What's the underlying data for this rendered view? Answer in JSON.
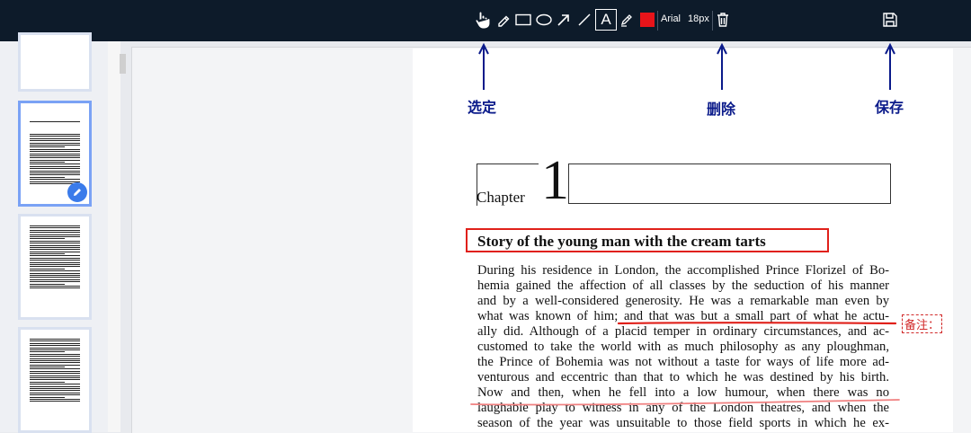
{
  "toolbar": {
    "font_name": "Arial",
    "font_size": "18px",
    "text_tool_glyph": "A",
    "color": "#e8141a",
    "icons": [
      "hand-select-icon",
      "eraser-icon",
      "rectangle-icon",
      "ellipse-icon",
      "arrow-icon",
      "line-icon",
      "text-icon",
      "highlighter-icon",
      "color-swatch",
      "trash-icon",
      "save-icon"
    ]
  },
  "annotations": {
    "select_label": "选定",
    "delete_label": "删除",
    "save_label": "保存",
    "arrow_color": "#0a1a8a"
  },
  "document": {
    "chapter_word": "Chapter",
    "chapter_number": "1",
    "title": "Story of the young man with the cream tarts",
    "lines": [
      "During his residence in London, the accomplished Prince Florizel of Bo-",
      "hemia gained the affection of all classes by the seduction of his manner",
      "and by a well-considered generosity. He was a remarkable man even by",
      "what was known of him; and that was but a small part of what he actu-",
      "ally did. Although of a placid temper in ordinary circumstances, and ac-",
      "customed to take the world with as much philosophy as any ploughman,",
      "the Prince of Bohemia was not without a taste for ways of life more ad-",
      "venturous and eccentric than that to which he was destined by his birth.",
      "Now and then, when he fell into a low humour, when there was no",
      "laughable play to witness in any of the London theatres, and when the",
      "season of the year was unsuitable to those field sports in which he ex-"
    ],
    "note_label": "备注：",
    "markup_color": "#e0201a"
  }
}
